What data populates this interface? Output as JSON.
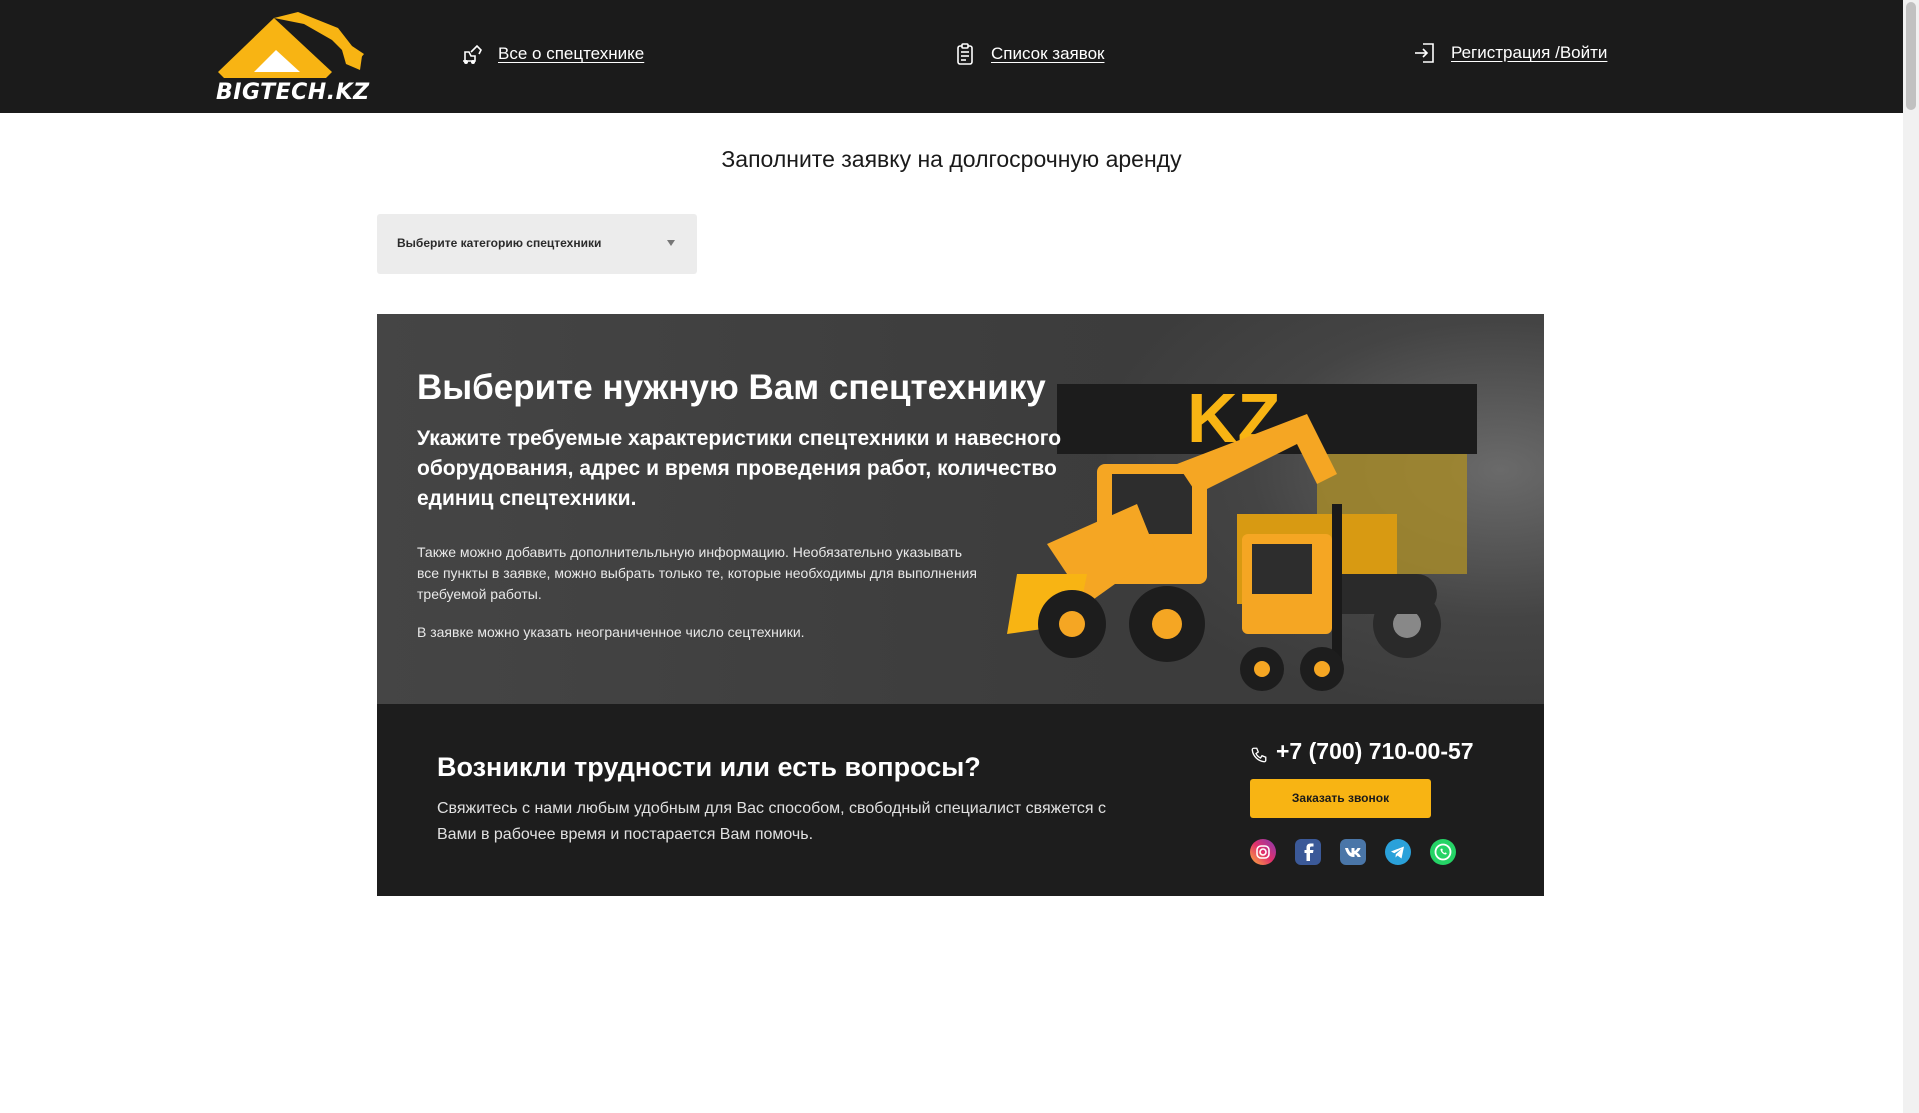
{
  "header": {
    "logo_text": "BIGTECH.KZ",
    "nav": [
      {
        "label": "Все о спецтехнике",
        "icon": "excavator-icon"
      },
      {
        "label": "Список заявок",
        "icon": "clipboard-icon"
      },
      {
        "label": "Регистрация /Войти",
        "icon": "login-icon"
      }
    ]
  },
  "form": {
    "title": "Заполните заявку на долгосрочную аренду",
    "category_select": {
      "placeholder": "Выберите категорию спецтехники"
    }
  },
  "banner": {
    "title": "Выберите нужную Вам спецтехнику",
    "subtitle": "Укажите требуемые характеристики спецтехники и навесного оборудования, адрес и время проведения работ, количество единиц спецтехники.",
    "text": "Также можно добавить дополнительльную информацию. Необязательно указывать все пункты в заявке, можно выбрать только те, которые необходимы для выполнения требуемой работы.",
    "text2": "В заявке можно указать неограниченное число сецтехники.",
    "image_logo_text": "KZ"
  },
  "contact": {
    "title": "Возникли трудности или есть вопросы?",
    "text": "Свяжитесь с нами любым удобным для Вас способом, свободный специалист свяжется с Вами в рабочее время и постарается Вам помочь.",
    "phone": "+7 (700) 710-00-57",
    "call_button": "Заказать звонок",
    "socials": [
      "instagram-icon",
      "facebook-icon",
      "vk-icon",
      "telegram-icon",
      "whatsapp-icon"
    ]
  },
  "colors": {
    "header_bg": "#1b1b1b",
    "accent": "#f8b413",
    "banner_bg": "#404040",
    "contact_bg": "#1d1d1d"
  }
}
